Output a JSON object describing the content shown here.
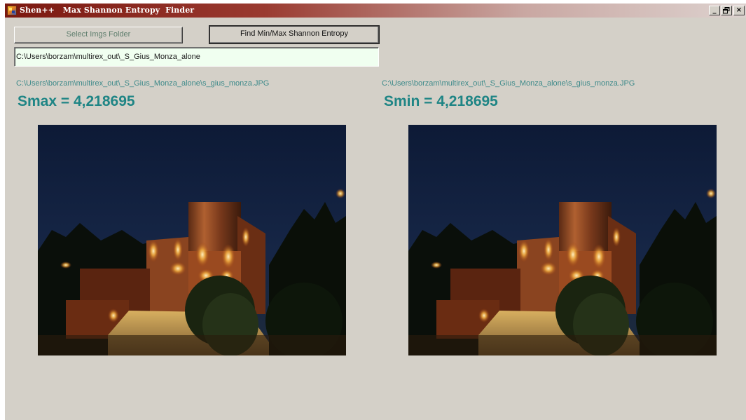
{
  "window": {
    "title": "Shen++   Max Shannon Entropy  Finder",
    "controls": {
      "minimize": "_",
      "restore": "🗗",
      "close": "×"
    }
  },
  "toolbar": {
    "select_label": "Select Imgs Folder",
    "find_label": "Find Min/Max Shannon Entropy"
  },
  "folder_path": "C:\\Users\\borzam\\multirex_out\\_S_Gius_Monza_alone",
  "max_panel": {
    "file_path": "C:\\Users\\borzam\\multirex_out\\_S_Gius_Monza_alone\\s_gius_monza.JPG",
    "entropy_text": "Smax = 4,218695"
  },
  "min_panel": {
    "file_path": "C:\\Users\\borzam\\multirex_out\\_S_Gius_Monza_alone\\s_gius_monza.JPG",
    "entropy_text": "Smin = 4,218695"
  },
  "colors": {
    "label_teal": "#3e8a8a",
    "entropy_teal": "#1f8585",
    "window_bg": "#d4d0c8",
    "input_bg": "#f0fff0"
  },
  "icons": {
    "app": "app-icon",
    "minimize": "minimize-icon",
    "restore": "restore-icon",
    "close": "close-icon"
  }
}
